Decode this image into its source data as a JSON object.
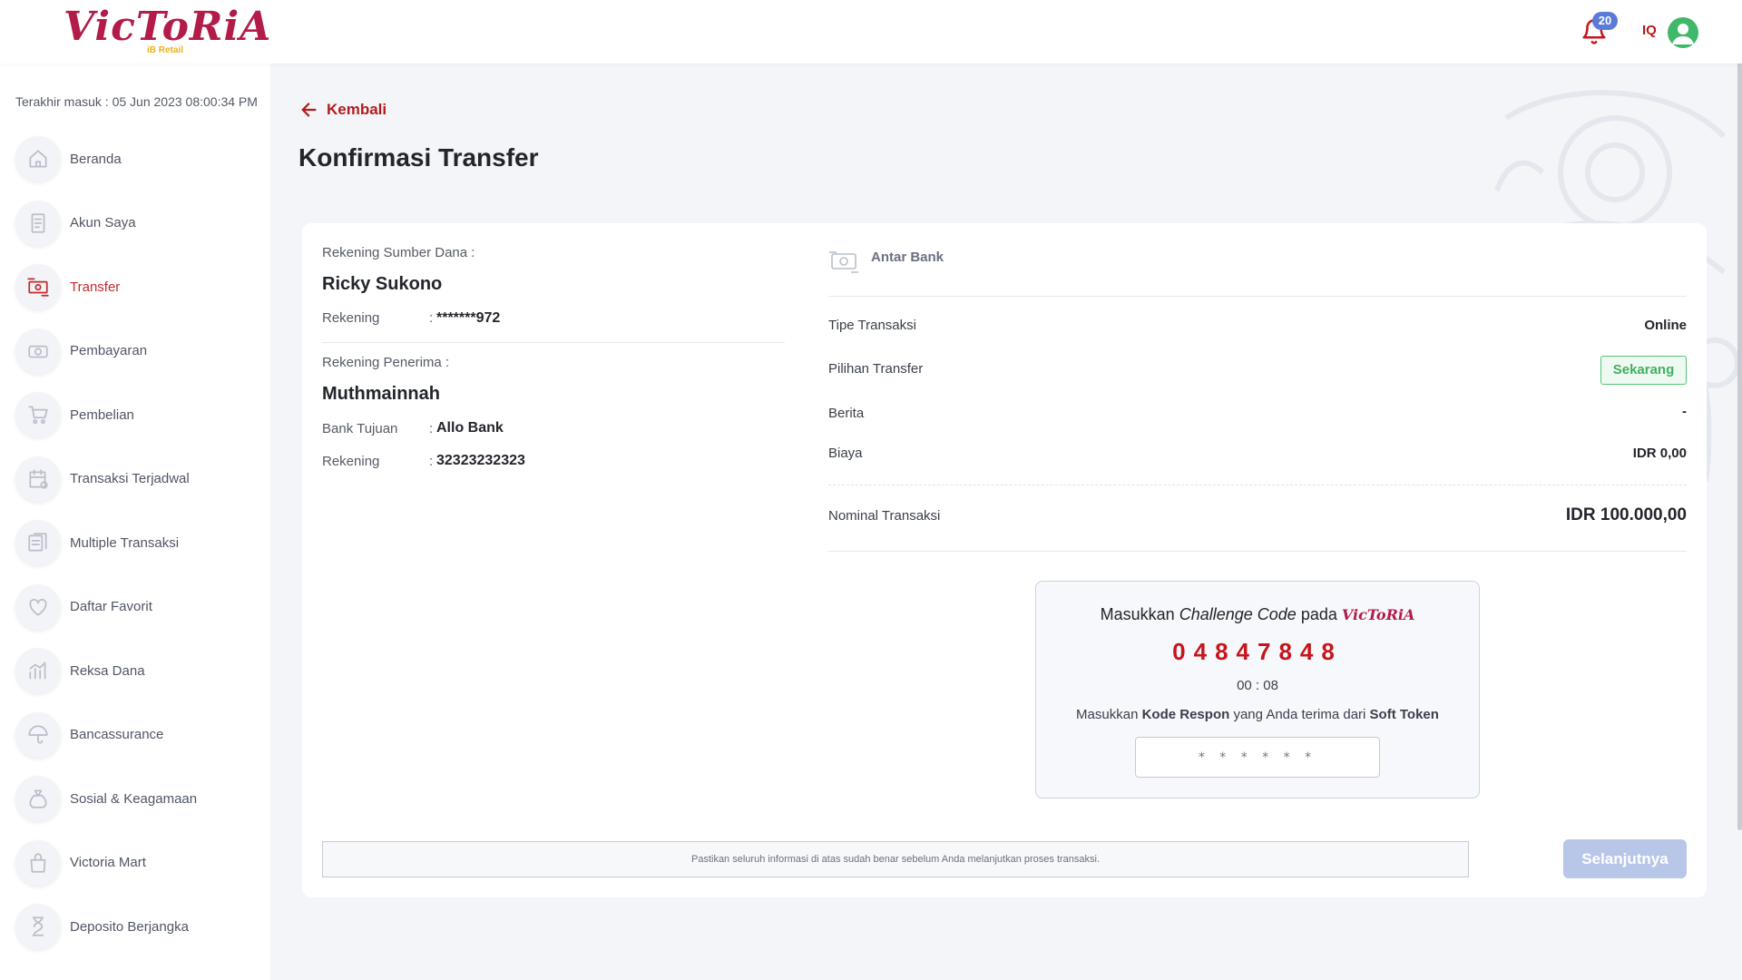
{
  "header": {
    "logo_text": "VicToRiA",
    "logo_sub": "iB Retail",
    "notification_count": "20",
    "user_initial": "IQ"
  },
  "sidebar": {
    "last_login": "Terakhir masuk : 05 Jun 2023 08:00:34 PM",
    "active_index": 2,
    "items": [
      {
        "label": "Beranda",
        "icon": "home-icon"
      },
      {
        "label": "Akun Saya",
        "icon": "account-icon"
      },
      {
        "label": "Transfer",
        "icon": "transfer-icon"
      },
      {
        "label": "Pembayaran",
        "icon": "payment-icon"
      },
      {
        "label": "Pembelian",
        "icon": "cart-icon"
      },
      {
        "label": "Transaksi Terjadwal",
        "icon": "calendar-icon"
      },
      {
        "label": "Multiple Transaksi",
        "icon": "multiple-transaction-icon"
      },
      {
        "label": "Daftar Favorit",
        "icon": "heart-icon"
      },
      {
        "label": "Reksa Dana",
        "icon": "chart-icon"
      },
      {
        "label": "Bancassurance",
        "icon": "umbrella-icon"
      },
      {
        "label": "Sosial & Keagamaan",
        "icon": "donation-bag-icon"
      },
      {
        "label": "Victoria Mart",
        "icon": "shopping-bag-icon"
      },
      {
        "label": "Deposito Berjangka",
        "icon": "hourglass-icon"
      }
    ]
  },
  "main": {
    "back_label": "Kembali",
    "title": "Konfirmasi Transfer"
  },
  "source": {
    "label": "Rekening Sumber Dana :",
    "name": "Ricky Sukono",
    "account_label": "Rekening",
    "account_value": "*******972"
  },
  "recipient": {
    "label": "Rekening Penerima :",
    "name": "Muthmainnah",
    "bank_label": "Bank Tujuan",
    "bank_value": "Allo Bank",
    "account_label": "Rekening",
    "account_value": "32323232323"
  },
  "colon": ":",
  "details": {
    "type_label": "Antar Bank",
    "rows": [
      {
        "label": "Tipe Transaksi",
        "value": "Online"
      },
      {
        "label": "Pilihan Transfer",
        "value": "Sekarang"
      },
      {
        "label": "Berita",
        "value": "-"
      },
      {
        "label": "Biaya",
        "value": "IDR 0,00"
      }
    ],
    "nominal_label": "Nominal Transaksi",
    "nominal_value": "IDR 100.000,00"
  },
  "challenge": {
    "title_prefix": "Masukkan",
    "title_em": "Challenge Code",
    "title_suffix": "pada",
    "brand": "VicToRiA",
    "code": "04847848",
    "timer": "00 : 08",
    "instr_prefix": "Masukkan",
    "instr_bold1": "Kode Respon",
    "instr_middle": "yang Anda terima dari",
    "instr_bold2": "Soft Token",
    "input_placeholder": "* * * * * *"
  },
  "footer": {
    "notice": "Pastikan seluruh informasi di atas sudah benar sebelum Anda melanjutkan proses transaksi.",
    "next_label": "Selanjutnya"
  },
  "colors": {
    "brand": "#b31b48",
    "accent_red": "#c4161c",
    "badge_blue": "#5b7bd8",
    "success_green": "#3fb060",
    "button_disabled": "#b8c6e8"
  }
}
